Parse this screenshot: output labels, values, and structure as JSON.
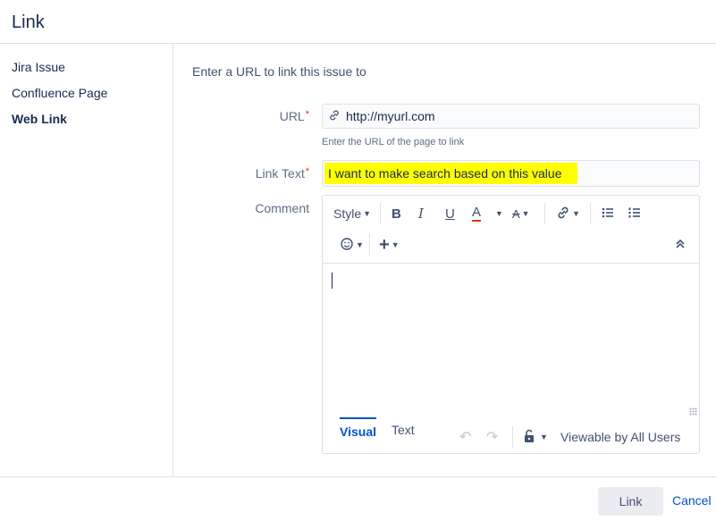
{
  "dialog": {
    "title": "Link"
  },
  "sidebar": {
    "items": [
      {
        "label": "Jira Issue"
      },
      {
        "label": "Confluence Page"
      },
      {
        "label": "Web Link"
      }
    ]
  },
  "form": {
    "intro": "Enter a URL to link this issue to",
    "url": {
      "label": "URL",
      "required": "*",
      "value": "http://myurl.com",
      "helper": "Enter the URL of the page to link"
    },
    "link_text": {
      "label": "Link Text",
      "required": "*",
      "value": "I want to make search based on this value"
    },
    "comment": {
      "label": "Comment"
    }
  },
  "editor": {
    "toolbar": {
      "style_label": "Style",
      "bold": "B",
      "italic": "I",
      "underline": "U",
      "text_color": "A",
      "more_format": "A",
      "add": "+",
      "icons": [
        "link-icon",
        "bullet-list-icon",
        "numbered-list-icon",
        "emoji-icon",
        "collapse-icon"
      ]
    },
    "tabs": [
      {
        "label": "Visual"
      },
      {
        "label": "Text"
      }
    ],
    "visibility": "Viewable by All Users"
  },
  "footer": {
    "link_button": "Link",
    "cancel": "Cancel"
  },
  "colors": {
    "accent": "#0052cc",
    "highlight": "#ffff00",
    "required": "#de350b"
  }
}
